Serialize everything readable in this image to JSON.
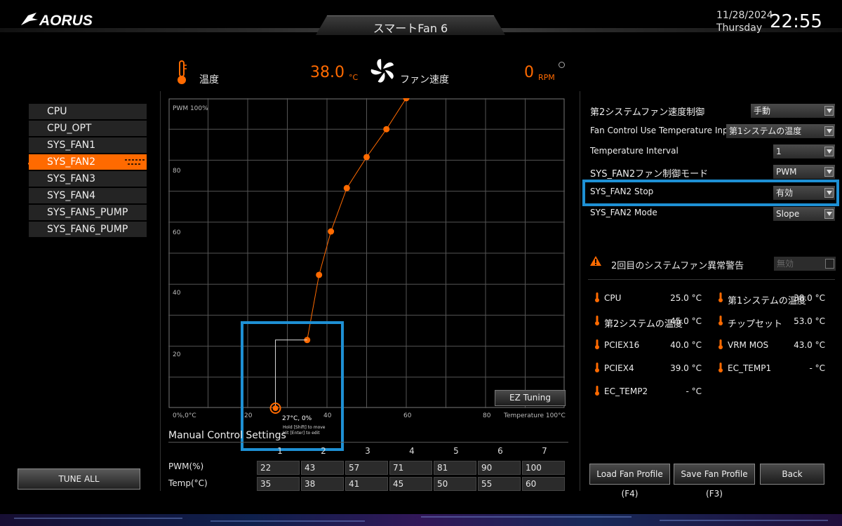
{
  "header": {
    "brand": "AORUS",
    "title": "スマートFan 6",
    "date": "11/28/2024",
    "day": "Thursday",
    "time": "22:55"
  },
  "status": {
    "temp_label": "温度",
    "temp_value": "38.0",
    "temp_unit": "°C",
    "fan_label": "ファン速度",
    "rpm_value": "0",
    "rpm_unit": "RPM"
  },
  "fan_list": [
    "CPU",
    "CPU_OPT",
    "SYS_FAN1",
    "SYS_FAN2",
    "SYS_FAN3",
    "SYS_FAN4",
    "SYS_FAN5_PUMP",
    "SYS_FAN6_PUMP"
  ],
  "active_fan": "SYS_FAN2",
  "chart": {
    "y_top_label": "PWM 100%",
    "y_ticks": [
      "80",
      "60",
      "40",
      "20"
    ],
    "x_origin_label": "0%,0°C",
    "x_ticks": [
      "20",
      "40",
      "60",
      "80"
    ],
    "x_end_label": "Temperature 100°C",
    "cursor_label": "27°C, 0%",
    "cursor_hint_1": "Hold [Shift] to move",
    "cursor_hint_2": "Hit [Enter] to edit",
    "ez_tuning": "EZ Tuning"
  },
  "chart_data": {
    "type": "line",
    "title": "",
    "xlabel": "Temperature 100°C",
    "ylabel": "PWM 100%",
    "xlim": [
      0,
      100
    ],
    "ylim": [
      0,
      100
    ],
    "points": [
      {
        "x": 35,
        "y": 22
      },
      {
        "x": 38,
        "y": 43
      },
      {
        "x": 41,
        "y": 57
      },
      {
        "x": 45,
        "y": 71
      },
      {
        "x": 50,
        "y": 81
      },
      {
        "x": 55,
        "y": 90
      },
      {
        "x": 60,
        "y": 100
      }
    ],
    "cursor": {
      "x": 27,
      "y": 0
    },
    "grid": true
  },
  "manual": {
    "title": "Manual Control Settings",
    "columns": [
      "1",
      "2",
      "3",
      "4",
      "5",
      "6",
      "7"
    ],
    "pwm_label": "PWM(%)",
    "temp_label": "Temp(°C)",
    "pwm": [
      "22",
      "43",
      "57",
      "71",
      "81",
      "90",
      "100"
    ],
    "temp": [
      "35",
      "38",
      "41",
      "45",
      "50",
      "55",
      "60"
    ]
  },
  "tune_all": "TUNE ALL",
  "settings": [
    {
      "label": "第2システムファン速度制御",
      "value": "手動"
    },
    {
      "label": "Fan Control Use Temperature Input",
      "value": "第1システムの温度"
    },
    {
      "label": "Temperature Interval",
      "value": "1"
    },
    {
      "label": "SYS_FAN2ファン制御モード",
      "value": "PWM"
    },
    {
      "label": "SYS_FAN2 Stop",
      "value": "有効"
    },
    {
      "label": "SYS_FAN2 Mode",
      "value": "Slope"
    }
  ],
  "warning": {
    "label": "2回目のシステムファン異常警告",
    "value": "無効"
  },
  "sensors": [
    {
      "name": "CPU",
      "value": "25.0 °C"
    },
    {
      "name": "第1システムの温度",
      "value": "38.0 °C"
    },
    {
      "name": "第2システムの温度",
      "value": "45.0 °C"
    },
    {
      "name": "チップセット",
      "value": "53.0 °C"
    },
    {
      "name": "PCIEX16",
      "value": "40.0 °C"
    },
    {
      "name": "VRM MOS",
      "value": "43.0 °C"
    },
    {
      "name": "PCIEX4",
      "value": "39.0 °C"
    },
    {
      "name": "EC_TEMP1",
      "value": "- °C"
    },
    {
      "name": "EC_TEMP2",
      "value": "- °C"
    }
  ],
  "buttons": {
    "load": "Load Fan Profile (F4)",
    "save": "Save Fan Profile (F3)",
    "back": "Back"
  },
  "colors": {
    "accent": "#ff6a00",
    "highlight": "#1e90d4",
    "background": "#000000"
  }
}
